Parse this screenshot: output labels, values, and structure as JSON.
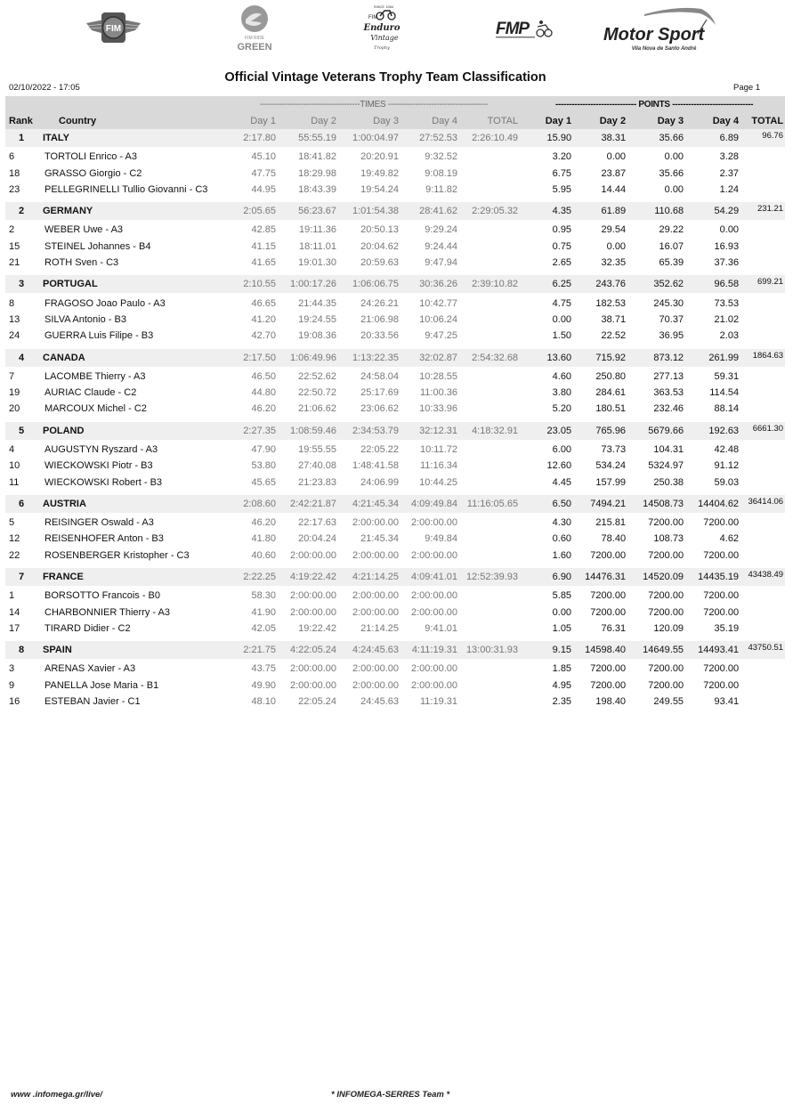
{
  "logos": [
    {
      "name": "fim-logo",
      "text": "FIM"
    },
    {
      "name": "fim-ride-green-logo",
      "text_small": "FIM RIDE",
      "text_big": "GREEN"
    },
    {
      "name": "fim-enduro-vintage-trophy-logo",
      "text_top": "SINCE 1984",
      "text_fim": "FIM",
      "text_main": "Enduro",
      "text_sub": "Vintage",
      "text_tail": "Trophy"
    },
    {
      "name": "fmp-logo",
      "text": "FMP"
    },
    {
      "name": "motor-sport-logo",
      "text": "Motor Sport",
      "subtext": "Vila Nova de Santo André"
    }
  ],
  "header": {
    "title": "Official Vintage Veterans Trophy Team Classification",
    "date": "02/10/2022 - 17:05",
    "page": "Page 1"
  },
  "table": {
    "group_times": "-------------------------------------TIMES -------------------------------------",
    "group_points": "------------------------------ POINTS ------------------------------",
    "columns": {
      "rank": "Rank",
      "country": "Country",
      "times": [
        "Day 1",
        "Day 2",
        "Day 3",
        "Day 4",
        "TOTAL"
      ],
      "points": [
        "Day 1",
        "Day 2",
        "Day 3",
        "Day 4",
        "TOTAL"
      ]
    },
    "teams": [
      {
        "rank": "1",
        "country": "ITALY",
        "times": [
          "2:17.80",
          "55:55.19",
          "1:00:04.97",
          "27:52.53",
          "2:26:10.49"
        ],
        "points": [
          "15.90",
          "38.31",
          "35.66",
          "6.89"
        ],
        "total_points": "96.76",
        "riders": [
          {
            "no": "6",
            "name": "TORTOLI Enrico  - A3",
            "times": [
              "45.10",
              "18:41.82",
              "20:20.91",
              "9:32.52"
            ],
            "points": [
              "3.20",
              "0.00",
              "0.00",
              "3.28"
            ]
          },
          {
            "no": "18",
            "name": "GRASSO Giorgio  - C2",
            "times": [
              "47.75",
              "18:29.98",
              "19:49.82",
              "9:08.19"
            ],
            "points": [
              "6.75",
              "23.87",
              "35.66",
              "2.37"
            ]
          },
          {
            "no": "23",
            "name": "PELLEGRINELLI Tullio Giovanni  - C3",
            "times": [
              "44.95",
              "18:43.39",
              "19:54.24",
              "9:11.82"
            ],
            "points": [
              "5.95",
              "14.44",
              "0.00",
              "1.24"
            ]
          }
        ]
      },
      {
        "rank": "2",
        "country": "GERMANY",
        "times": [
          "2:05.65",
          "56:23.67",
          "1:01:54.38",
          "28:41.62",
          "2:29:05.32"
        ],
        "points": [
          "4.35",
          "61.89",
          "110.68",
          "54.29"
        ],
        "total_points": "231.21",
        "riders": [
          {
            "no": "2",
            "name": "WEBER  Uwe  - A3",
            "times": [
              "42.85",
              "19:11.36",
              "20:50.13",
              "9:29.24"
            ],
            "points": [
              "0.95",
              "29.54",
              "29.22",
              "0.00"
            ]
          },
          {
            "no": "15",
            "name": "STEINEL Johannes  - B4",
            "times": [
              "41.15",
              "18:11.01",
              "20:04.62",
              "9:24.44"
            ],
            "points": [
              "0.75",
              "0.00",
              "16.07",
              "16.93"
            ]
          },
          {
            "no": "21",
            "name": "ROTH Sven  - C3",
            "times": [
              "41.65",
              "19:01.30",
              "20:59.63",
              "9:47.94"
            ],
            "points": [
              "2.65",
              "32.35",
              "65.39",
              "37.36"
            ]
          }
        ]
      },
      {
        "rank": "3",
        "country": "PORTUGAL",
        "times": [
          "2:10.55",
          "1:00:17.26",
          "1:06:06.75",
          "30:36.26",
          "2:39:10.82"
        ],
        "points": [
          "6.25",
          "243.76",
          "352.62",
          "96.58"
        ],
        "total_points": "699.21",
        "riders": [
          {
            "no": "8",
            "name": "FRAGOSO Joao Paulo  - A3",
            "times": [
              "46.65",
              "21:44.35",
              "24:26.21",
              "10:42.77"
            ],
            "points": [
              "4.75",
              "182.53",
              "245.30",
              "73.53"
            ]
          },
          {
            "no": "13",
            "name": "SILVA Antonio  - B3",
            "times": [
              "41.20",
              "19:24.55",
              "21:06.98",
              "10:06.24"
            ],
            "points": [
              "0.00",
              "38.71",
              "70.37",
              "21.02"
            ]
          },
          {
            "no": "24",
            "name": "GUERRA Luis Filipe  - B3",
            "times": [
              "42.70",
              "19:08.36",
              "20:33.56",
              "9:47.25"
            ],
            "points": [
              "1.50",
              "22.52",
              "36.95",
              "2.03"
            ]
          }
        ]
      },
      {
        "rank": "4",
        "country": "CANADA",
        "times": [
          "2:17.50",
          "1:06:49.96",
          "1:13:22.35",
          "32:02.87",
          "2:54:32.68"
        ],
        "points": [
          "13.60",
          "715.92",
          "873.12",
          "261.99"
        ],
        "total_points": "1864.63",
        "riders": [
          {
            "no": "7",
            "name": "LACOMBE Thierry  - A3",
            "times": [
              "46.50",
              "22:52.62",
              "24:58.04",
              "10:28.55"
            ],
            "points": [
              "4.60",
              "250.80",
              "277.13",
              "59.31"
            ]
          },
          {
            "no": "19",
            "name": "AURIAC Claude  - C2",
            "times": [
              "44.80",
              "22:50.72",
              "25:17.69",
              "11:00.36"
            ],
            "points": [
              "3.80",
              "284.61",
              "363.53",
              "114.54"
            ]
          },
          {
            "no": "20",
            "name": "MARCOUX Michel  - C2",
            "times": [
              "46.20",
              "21:06.62",
              "23:06.62",
              "10:33.96"
            ],
            "points": [
              "5.20",
              "180.51",
              "232.46",
              "88.14"
            ]
          }
        ]
      },
      {
        "rank": "5",
        "country": "POLAND",
        "times": [
          "2:27.35",
          "1:08:59.46",
          "2:34:53.79",
          "32:12.31",
          "4:18:32.91"
        ],
        "points": [
          "23.05",
          "765.96",
          "5679.66",
          "192.63"
        ],
        "total_points": "6661.30",
        "riders": [
          {
            "no": "4",
            "name": "AUGUSTYN Ryszard  - A3",
            "times": [
              "47.90",
              "19:55.55",
              "22:05.22",
              "10:11.72"
            ],
            "points": [
              "6.00",
              "73.73",
              "104.31",
              "42.48"
            ]
          },
          {
            "no": "10",
            "name": "WIECKOWSKI Piotr  - B3",
            "times": [
              "53.80",
              "27:40.08",
              "1:48:41.58",
              "11:16.34"
            ],
            "points": [
              "12.60",
              "534.24",
              "5324.97",
              "91.12"
            ]
          },
          {
            "no": "11",
            "name": "WIECKOWSKI Robert  - B3",
            "times": [
              "45.65",
              "21:23.83",
              "24:06.99",
              "10:44.25"
            ],
            "points": [
              "4.45",
              "157.99",
              "250.38",
              "59.03"
            ]
          }
        ]
      },
      {
        "rank": "6",
        "country": "AUSTRIA",
        "times": [
          "2:08.60",
          "2:42:21.87",
          "4:21:45.34",
          "4:09:49.84",
          "11:16:05.65"
        ],
        "points": [
          "6.50",
          "7494.21",
          "14508.73",
          "14404.62"
        ],
        "total_points": "36414.06",
        "riders": [
          {
            "no": "5",
            "name": "REISINGER Oswald  - A3",
            "times": [
              "46.20",
              "22:17.63",
              "2:00:00.00",
              "2:00:00.00"
            ],
            "points": [
              "4.30",
              "215.81",
              "7200.00",
              "7200.00"
            ]
          },
          {
            "no": "12",
            "name": "REISENHOFER Anton    - B3",
            "times": [
              "41.80",
              "20:04.24",
              "21:45.34",
              "9:49.84"
            ],
            "points": [
              "0.60",
              "78.40",
              "108.73",
              "4.62"
            ]
          },
          {
            "no": "22",
            "name": "ROSENBERGER Kristopher  - C3",
            "times": [
              "40.60",
              "2:00:00.00",
              "2:00:00.00",
              "2:00:00.00"
            ],
            "points": [
              "1.60",
              "7200.00",
              "7200.00",
              "7200.00"
            ]
          }
        ]
      },
      {
        "rank": "7",
        "country": "FRANCE",
        "times": [
          "2:22.25",
          "4:19:22.42",
          "4:21:14.25",
          "4:09:41.01",
          "12:52:39.93"
        ],
        "points": [
          "6.90",
          "14476.31",
          "14520.09",
          "14435.19"
        ],
        "total_points": "43438.49",
        "riders": [
          {
            "no": "1",
            "name": "BORSOTTO Francois   - B0",
            "times": [
              "58.30",
              "2:00:00.00",
              "2:00:00.00",
              "2:00:00.00"
            ],
            "points": [
              "5.85",
              "7200.00",
              "7200.00",
              "7200.00"
            ]
          },
          {
            "no": "14",
            "name": "CHARBONNIER Thierry  - A3",
            "times": [
              "41.90",
              "2:00:00.00",
              "2:00:00.00",
              "2:00:00.00"
            ],
            "points": [
              "0.00",
              "7200.00",
              "7200.00",
              "7200.00"
            ]
          },
          {
            "no": "17",
            "name": "TIRARD Didier  - C2",
            "times": [
              "42.05",
              "19:22.42",
              "21:14.25",
              "9:41.01"
            ],
            "points": [
              "1.05",
              "76.31",
              "120.09",
              "35.19"
            ]
          }
        ]
      },
      {
        "rank": "8",
        "country": "SPAIN",
        "times": [
          "2:21.75",
          "4:22:05.24",
          "4:24:45.63",
          "4:11:19.31",
          "13:00:31.93"
        ],
        "points": [
          "9.15",
          "14598.40",
          "14649.55",
          "14493.41"
        ],
        "total_points": "43750.51",
        "riders": [
          {
            "no": "3",
            "name": "ARENAS Xavier   - A3",
            "times": [
              "43.75",
              "2:00:00.00",
              "2:00:00.00",
              "2:00:00.00"
            ],
            "points": [
              "1.85",
              "7200.00",
              "7200.00",
              "7200.00"
            ]
          },
          {
            "no": "9",
            "name": "PANELLA Jose Maria  - B1",
            "times": [
              "49.90",
              "2:00:00.00",
              "2:00:00.00",
              "2:00:00.00"
            ],
            "points": [
              "4.95",
              "7200.00",
              "7200.00",
              "7200.00"
            ]
          },
          {
            "no": "16",
            "name": "ESTEBAN Javier   - C1",
            "times": [
              "48.10",
              "22:05.24",
              "24:45.63",
              "11:19.31"
            ],
            "points": [
              "2.35",
              "198.40",
              "249.55",
              "93.41"
            ]
          }
        ]
      }
    ]
  },
  "footer": {
    "website": "www .infomega.gr/live/",
    "credit": "* INFOMEGA-SERRES Team *"
  }
}
